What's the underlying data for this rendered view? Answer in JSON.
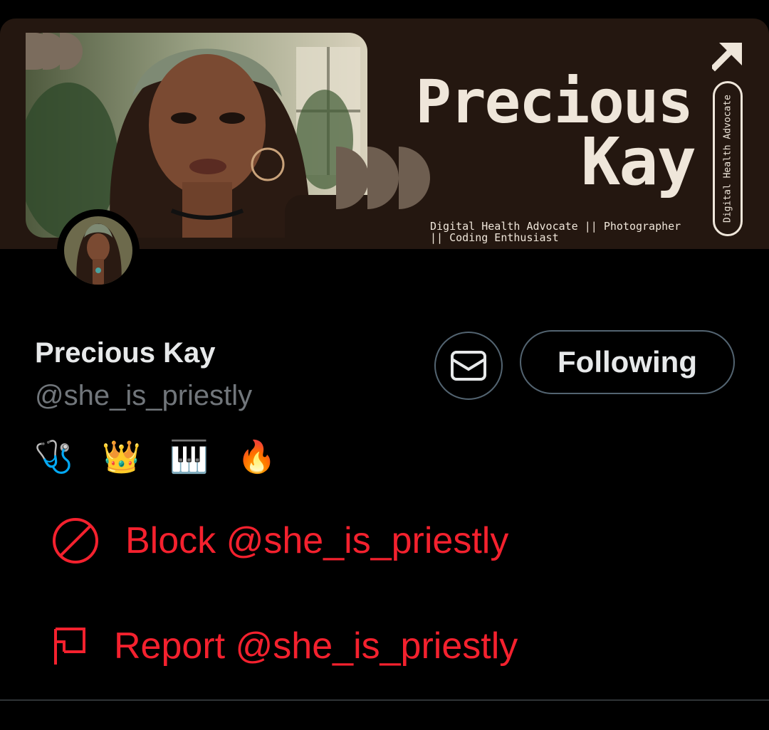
{
  "banner": {
    "title_line1": "Precious",
    "title_line2": "Kay",
    "tagline": "Digital Health Advocate || Photographer || Coding Enthusiast",
    "pill_text": "Digital Health Advocate"
  },
  "profile": {
    "display_name": "Precious Kay",
    "handle": "@she_is_priestly",
    "bio": "🩺 👑 🎹 🔥"
  },
  "actions": {
    "following_label": "Following"
  },
  "menu": {
    "block_label": "Block @she_is_priestly",
    "report_label": "Report @she_is_priestly"
  },
  "colors": {
    "banner_bg": "#241710",
    "danger": "#f4212e",
    "text_primary": "#e7e9ea",
    "text_secondary": "#71767b",
    "border": "#536471"
  },
  "icons": {
    "message": "envelope-icon",
    "block": "block-icon",
    "report": "flag-icon",
    "banner_arrow": "arrow-up-right-icon"
  }
}
